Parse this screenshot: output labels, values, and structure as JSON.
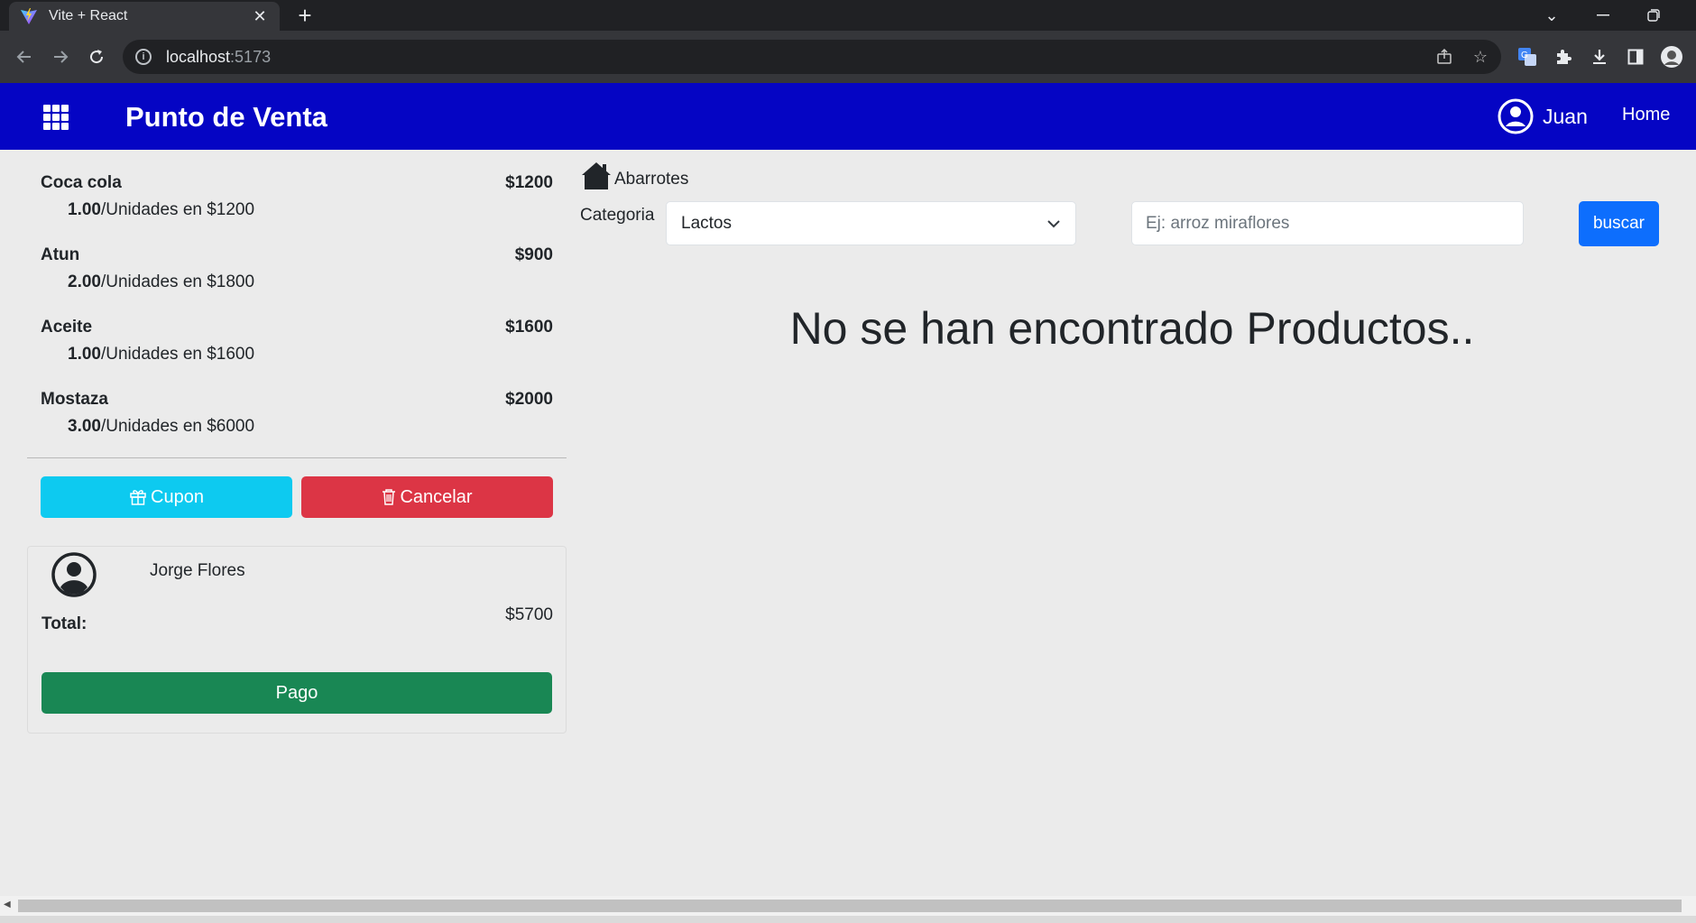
{
  "browser": {
    "tab_title": "Vite + React",
    "tab_close": "✕",
    "new_tab": "+",
    "url_host": "localhost",
    "url_port": ":5173"
  },
  "navbar": {
    "brand": "Punto de Venta",
    "user_name": "Juan",
    "home_link": "Home",
    "bg_color": "#0505c4"
  },
  "cart": {
    "items": [
      {
        "name": "Coca cola",
        "price": "$1200",
        "qty": "1.00",
        "detail": "/Unidades en $1200"
      },
      {
        "name": "Atun",
        "price": "$900",
        "qty": "2.00",
        "detail": "/Unidades en $1800"
      },
      {
        "name": "Aceite",
        "price": "$1600",
        "qty": "1.00",
        "detail": "/Unidades en $1600"
      },
      {
        "name": "Mostaza",
        "price": "$2000",
        "qty": "3.00",
        "detail": "/Unidades en $6000"
      }
    ],
    "cupon_label": "Cupon",
    "cancel_label": "Cancelar",
    "client_name": "Jorge Flores",
    "total_label": "Total:",
    "total_value": "$5700",
    "pay_label": "Pago"
  },
  "products": {
    "breadcrumb": "Abarrotes",
    "category_label": "Categoria",
    "category_selected": "Lactos",
    "search_placeholder": "Ej: arroz miraflores",
    "search_button": "buscar",
    "empty_message": "No se han encontrado Productos.."
  },
  "colors": {
    "info": "#0dcaf0",
    "danger": "#dc3545",
    "success": "#198754",
    "primary": "#0d6efd"
  }
}
